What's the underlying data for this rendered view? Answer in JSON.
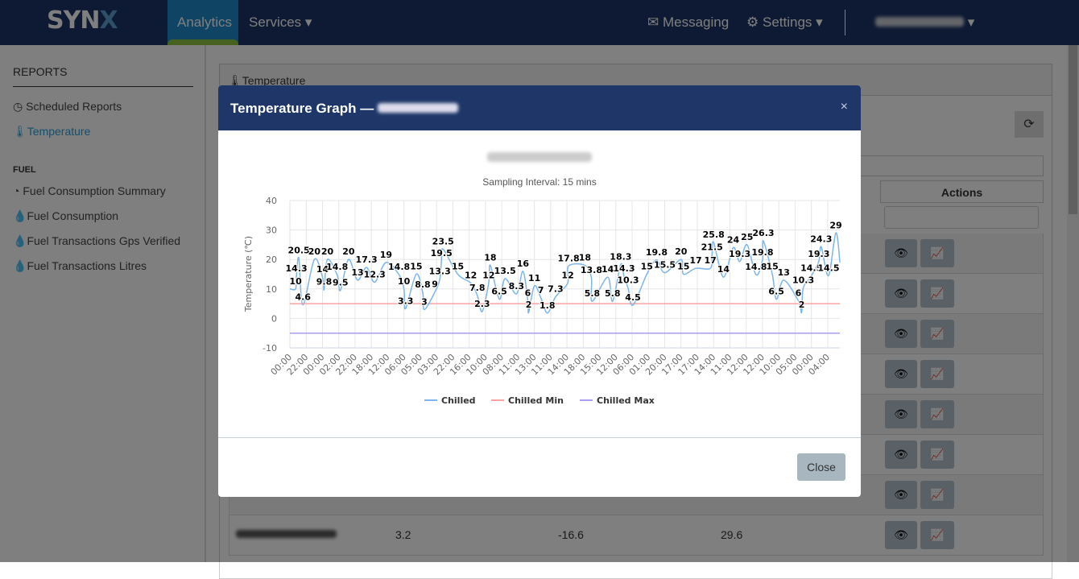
{
  "header": {
    "logo": "SYNX",
    "nav": [
      {
        "label": "Analytics",
        "active": true
      },
      {
        "label": "Services"
      }
    ],
    "messaging": "Messaging",
    "settings": "Settings",
    "chevron": "▾"
  },
  "sidebar": {
    "reports_heading": "REPORTS",
    "items": [
      {
        "label": "Scheduled Reports",
        "icon": "clock-icon"
      },
      {
        "label": "Temperature",
        "icon": "thermometer-icon",
        "active": true
      }
    ],
    "fuel_heading": "FUEL",
    "fuel_items": [
      {
        "label": "Fuel Consumption Summary",
        "icon": "dashboard-icon"
      },
      {
        "label": "Fuel Consumption",
        "icon": "drop-icon"
      },
      {
        "label": "Fuel Transactions Gps Verified",
        "icon": "drop-icon"
      },
      {
        "label": "Fuel Transactions Litres",
        "icon": "drop-icon"
      }
    ]
  },
  "panel": {
    "title": "Temperature",
    "actions_header": "Actions",
    "last_row": [
      "3.2",
      "-16.6",
      "29.6"
    ]
  },
  "modal": {
    "title": "Temperature Graph —",
    "subtitle": "Sampling Interval: 15 mins",
    "close_label": "Close",
    "close_icon": "×"
  },
  "colors": {
    "chilled": "#7cb5ec",
    "chilled_min": "#f7a3a3",
    "chilled_max": "#a89cf0",
    "modal_header": "#1e3768"
  },
  "chart_data": {
    "type": "line",
    "ylabel": "Temperature (℃)",
    "ylim": [
      -10,
      40
    ],
    "yticks": [
      "40",
      "30",
      "20",
      "10",
      "0",
      "-10"
    ],
    "xticks": [
      "00:00",
      "22:00",
      "00:00",
      "02:00",
      "22:00",
      "18:00",
      "12:00",
      "06:00",
      "05:00",
      "03:00",
      "22:00",
      "16:00",
      "10:00",
      "08:00",
      "11:00",
      "13:00",
      "11:00",
      "14:00",
      "18:00",
      "15:00",
      "12:00",
      "06:00",
      "01:00",
      "20:00",
      "17:00",
      "17:00",
      "14:00",
      "11:00",
      "12:00",
      "12:00",
      "10:00",
      "05:00",
      "00:00",
      "04:00"
    ],
    "grid": true,
    "legend": "bottom",
    "series": [
      {
        "name": "Chilled",
        "points": [
          [
            0,
            10
          ],
          [
            0.35,
            10
          ],
          [
            0.4,
            14.3
          ],
          [
            0.55,
            20.5
          ],
          [
            0.8,
            4.6
          ],
          [
            1.5,
            20
          ],
          [
            2.0,
            14
          ],
          [
            2.1,
            9.8
          ],
          [
            2.3,
            20
          ],
          [
            2.9,
            14.8
          ],
          [
            3.1,
            9.5
          ],
          [
            3.6,
            20
          ],
          [
            4.15,
            13
          ],
          [
            4.7,
            17.3
          ],
          [
            5.2,
            12.3
          ],
          [
            5.9,
            19
          ],
          [
            6.7,
            14.8
          ],
          [
            7.0,
            10
          ],
          [
            7.1,
            3.3
          ],
          [
            7.75,
            15
          ],
          [
            8.15,
            8.8
          ],
          [
            8.25,
            3
          ],
          [
            8.9,
            9
          ],
          [
            9.2,
            13.3
          ],
          [
            9.3,
            19.5
          ],
          [
            9.4,
            23.5
          ],
          [
            10.3,
            15
          ],
          [
            11.1,
            12
          ],
          [
            11.5,
            7.8
          ],
          [
            11.8,
            2.3
          ],
          [
            12.2,
            12
          ],
          [
            12.3,
            18
          ],
          [
            12.85,
            6.5
          ],
          [
            13.2,
            13.5
          ],
          [
            13.9,
            8.3
          ],
          [
            14.3,
            16
          ],
          [
            14.6,
            6
          ],
          [
            14.65,
            2
          ],
          [
            15.0,
            11
          ],
          [
            15.4,
            7
          ],
          [
            15.8,
            1.8
          ],
          [
            16.3,
            7.3
          ],
          [
            17.05,
            12
          ],
          [
            17.1,
            17.8
          ],
          [
            18.1,
            18
          ],
          [
            18.5,
            13.8
          ],
          [
            18.55,
            5.8
          ],
          [
            19.5,
            14
          ],
          [
            19.8,
            5.8
          ],
          [
            20.3,
            18.3
          ],
          [
            20.5,
            14.3
          ],
          [
            20.75,
            10.3
          ],
          [
            21.05,
            4.5
          ],
          [
            21.9,
            15
          ],
          [
            22.5,
            19.8
          ],
          [
            23.0,
            15.5
          ],
          [
            24.0,
            20
          ],
          [
            24.15,
            15
          ],
          [
            24.9,
            17
          ],
          [
            25.8,
            17
          ],
          [
            25.9,
            21.5
          ],
          [
            26.0,
            25.8
          ],
          [
            26.6,
            14
          ],
          [
            27.2,
            24
          ],
          [
            27.6,
            19.3
          ],
          [
            28.05,
            25
          ],
          [
            28.6,
            14.8
          ],
          [
            29.0,
            19.8
          ],
          [
            29.05,
            26.3
          ],
          [
            29.6,
            15
          ],
          [
            29.85,
            6.5
          ],
          [
            30.3,
            13
          ],
          [
            31.2,
            6
          ],
          [
            31.4,
            2
          ],
          [
            31.5,
            10.3
          ],
          [
            32.0,
            14.5
          ],
          [
            32.45,
            19.3
          ],
          [
            32.6,
            24.3
          ],
          [
            33.05,
            14.5
          ],
          [
            33.5,
            29
          ],
          [
            33.75,
            19
          ]
        ]
      },
      {
        "name": "Chilled Min",
        "value": 5
      },
      {
        "name": "Chilled Max",
        "value": -5
      }
    ]
  }
}
